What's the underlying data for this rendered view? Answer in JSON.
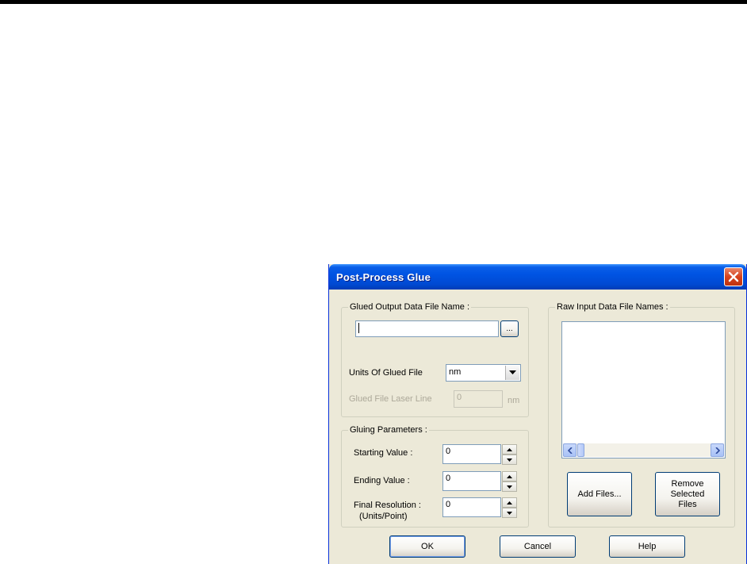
{
  "dialog": {
    "title": "Post-Process Glue",
    "close_icon": "close-icon"
  },
  "glued_output": {
    "group_title": "Glued Output Data File Name :",
    "file_name_value": "",
    "browse_label": "...",
    "units_label": "Units Of Glued File",
    "units_selected": "nm",
    "laser_line_label": "Glued File Laser Line",
    "laser_line_value": "0",
    "laser_line_unit": "nm"
  },
  "gluing_parameters": {
    "group_title": "Gluing Parameters :",
    "starting_label": "Starting Value :",
    "starting_value": "0",
    "ending_label": "Ending Value :",
    "ending_value": "0",
    "resolution_label": "Final Resolution :",
    "resolution_sublabel": "(Units/Point)",
    "resolution_value": "0"
  },
  "raw_input": {
    "group_title": "Raw Input Data File Names :",
    "files": [],
    "add_files_label": "Add Files...",
    "remove_line1": "Remove",
    "remove_line2": "Selected",
    "remove_line3": "Files"
  },
  "footer": {
    "ok_label": "OK",
    "cancel_label": "Cancel",
    "help_label": "Help"
  },
  "colors": {
    "titlebar": "#0054e3",
    "dialog_bg": "#ece9d8",
    "close_button": "#d6421e"
  }
}
